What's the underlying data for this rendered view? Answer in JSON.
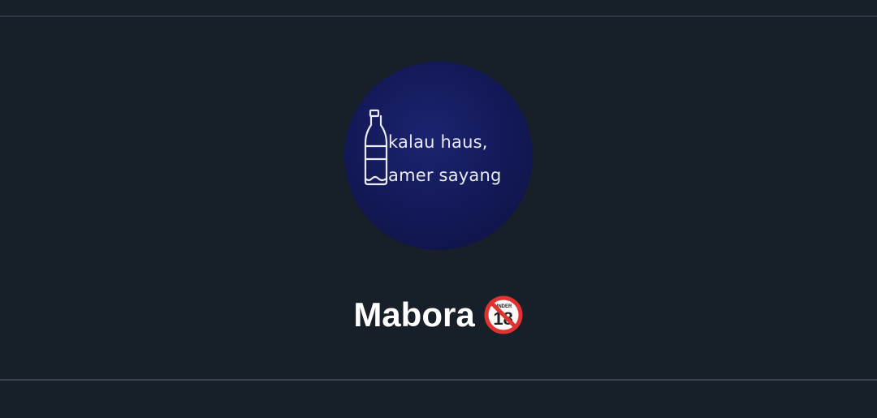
{
  "avatar": {
    "line1": "kalau haus,",
    "line2": "amer sayang",
    "icon": "bottle-icon"
  },
  "profile": {
    "name": "Mabora",
    "badge": {
      "icon": "no-under-18-icon",
      "small_text": "UNDER",
      "big_text": "18"
    }
  },
  "colors": {
    "background": "#171f28",
    "divider": "#2d3640",
    "name_text": "#ffffff",
    "avatar_bg": "#141a5a",
    "badge_red": "#e0322f"
  }
}
